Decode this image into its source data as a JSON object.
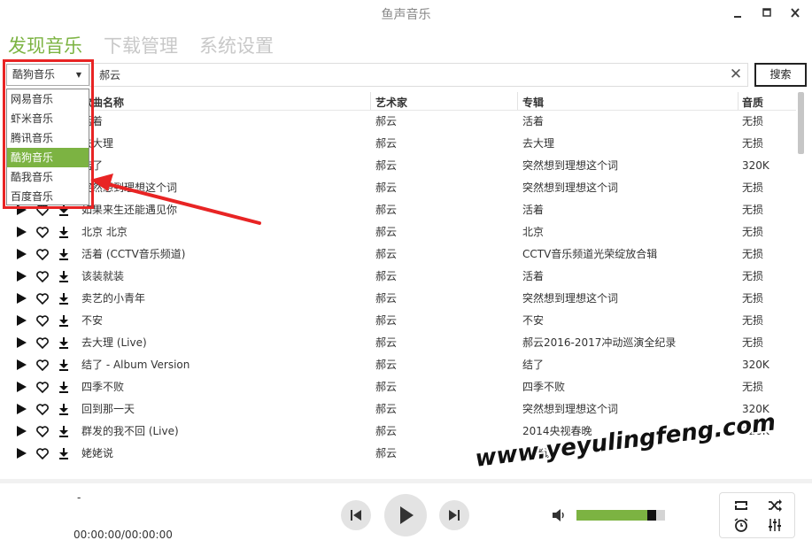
{
  "app": {
    "title": "鱼声音乐"
  },
  "tabs": [
    {
      "label": "发现音乐",
      "active": true
    },
    {
      "label": "下载管理",
      "active": false
    },
    {
      "label": "系统设置",
      "active": false
    }
  ],
  "search": {
    "source_selected": "酷狗音乐",
    "query": "郝云",
    "button_label": "搜索",
    "clear_symbol": "✕"
  },
  "source_options": [
    "网易音乐",
    "虾米音乐",
    "腾讯音乐",
    "酷狗音乐",
    "酷我音乐",
    "百度音乐"
  ],
  "table": {
    "headers": {
      "title": "歌曲名称",
      "artist": "艺术家",
      "album": "专辑",
      "quality": "音质"
    },
    "rows": [
      {
        "title": "活着",
        "artist": "郝云",
        "album": "活着",
        "quality": "无损"
      },
      {
        "title": "去大理",
        "artist": "郝云",
        "album": "去大理",
        "quality": "无损"
      },
      {
        "title": "结了",
        "artist": "郝云",
        "album": "突然想到理想这个词",
        "quality": "320K"
      },
      {
        "title": "突然想到理想这个词",
        "artist": "郝云",
        "album": "突然想到理想这个词",
        "quality": "无损"
      },
      {
        "title": "如果来生还能遇见你",
        "artist": "郝云",
        "album": "活着",
        "quality": "无损"
      },
      {
        "title": "北京 北京",
        "artist": "郝云",
        "album": "北京",
        "quality": "无损"
      },
      {
        "title": "活着 (CCTV音乐频道)",
        "artist": "郝云",
        "album": "CCTV音乐频道光荣绽放合辑",
        "quality": "无损"
      },
      {
        "title": "该装就装",
        "artist": "郝云",
        "album": "活着",
        "quality": "无损"
      },
      {
        "title": "卖艺的小青年",
        "artist": "郝云",
        "album": "突然想到理想这个词",
        "quality": "无损"
      },
      {
        "title": "不安",
        "artist": "郝云",
        "album": "不安",
        "quality": "无损"
      },
      {
        "title": "去大理 (Live)",
        "artist": "郝云",
        "album": "郝云2016-2017冲动巡演全纪录",
        "quality": "无损"
      },
      {
        "title": "结了 - Album Version",
        "artist": "郝云",
        "album": "结了",
        "quality": "320K"
      },
      {
        "title": "四季不败",
        "artist": "郝云",
        "album": "四季不败",
        "quality": "无损"
      },
      {
        "title": "回到那一天",
        "artist": "郝云",
        "album": "突然想到理想这个词",
        "quality": "320K"
      },
      {
        "title": "群发的我不回 (Live)",
        "artist": "郝云",
        "album": "2014央视春晚",
        "quality": "320K"
      },
      {
        "title": "姥姥说",
        "artist": "郝云",
        "album": "姥姥说",
        "quality": ""
      }
    ]
  },
  "player": {
    "track_title": "-",
    "time": "00:00:00/00:00:00",
    "volume": 0.8
  },
  "watermark": "www.yeyulingfeng.com",
  "colors": {
    "accent": "#7cb342",
    "highlight": "#e82424"
  }
}
